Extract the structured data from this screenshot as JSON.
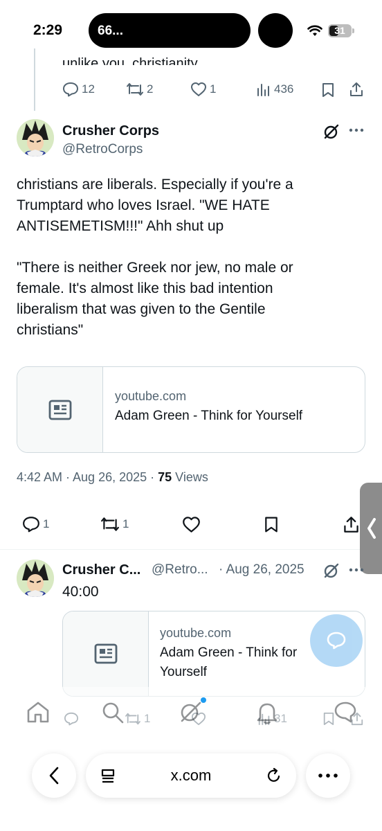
{
  "status_bar": {
    "time": "2:29",
    "island_text": "66...",
    "battery": "31"
  },
  "prev_tweet": {
    "cut_text": "unlike you, christianity",
    "actions": {
      "replies": "12",
      "reposts": "2",
      "likes": "1",
      "views": "436"
    }
  },
  "main_tweet": {
    "name": "Crusher Corps",
    "handle": "@RetroCorps",
    "lines_p1": [
      "christians are liberals. Especially if you're a",
      "Trumptard who loves Israel. \"WE HATE",
      "ANTISEMETISM!!!\" Ahh shut up"
    ],
    "lines_p2": [
      "\"There is neither Greek nor jew, no male or",
      "female. It's almost like this bad intention",
      "liberalism that was given to the Gentile",
      "christians\""
    ],
    "card": {
      "domain": "youtube.com",
      "title": "Adam Green - Think for Yourself"
    },
    "timestamp": "4:42 AM · Aug 26, 2025 · ",
    "views_count": "75",
    "views_label": " Views",
    "actions": {
      "replies": "1",
      "reposts": "1"
    }
  },
  "reply_tweet": {
    "name": "Crusher C...",
    "handle": "@Retro...",
    "date": "· Aug 26, 2025",
    "text": "40:00",
    "card": {
      "domain": "youtube.com",
      "title_l1": "Adam Green - Think for",
      "title_l2": "Yourself"
    },
    "actions": {
      "reposts": "1",
      "views": "31"
    }
  },
  "browser": {
    "url": "x.com"
  },
  "colors": {
    "accent": "#1d9bf0",
    "muted": "#536471",
    "border": "#cfd9de"
  }
}
